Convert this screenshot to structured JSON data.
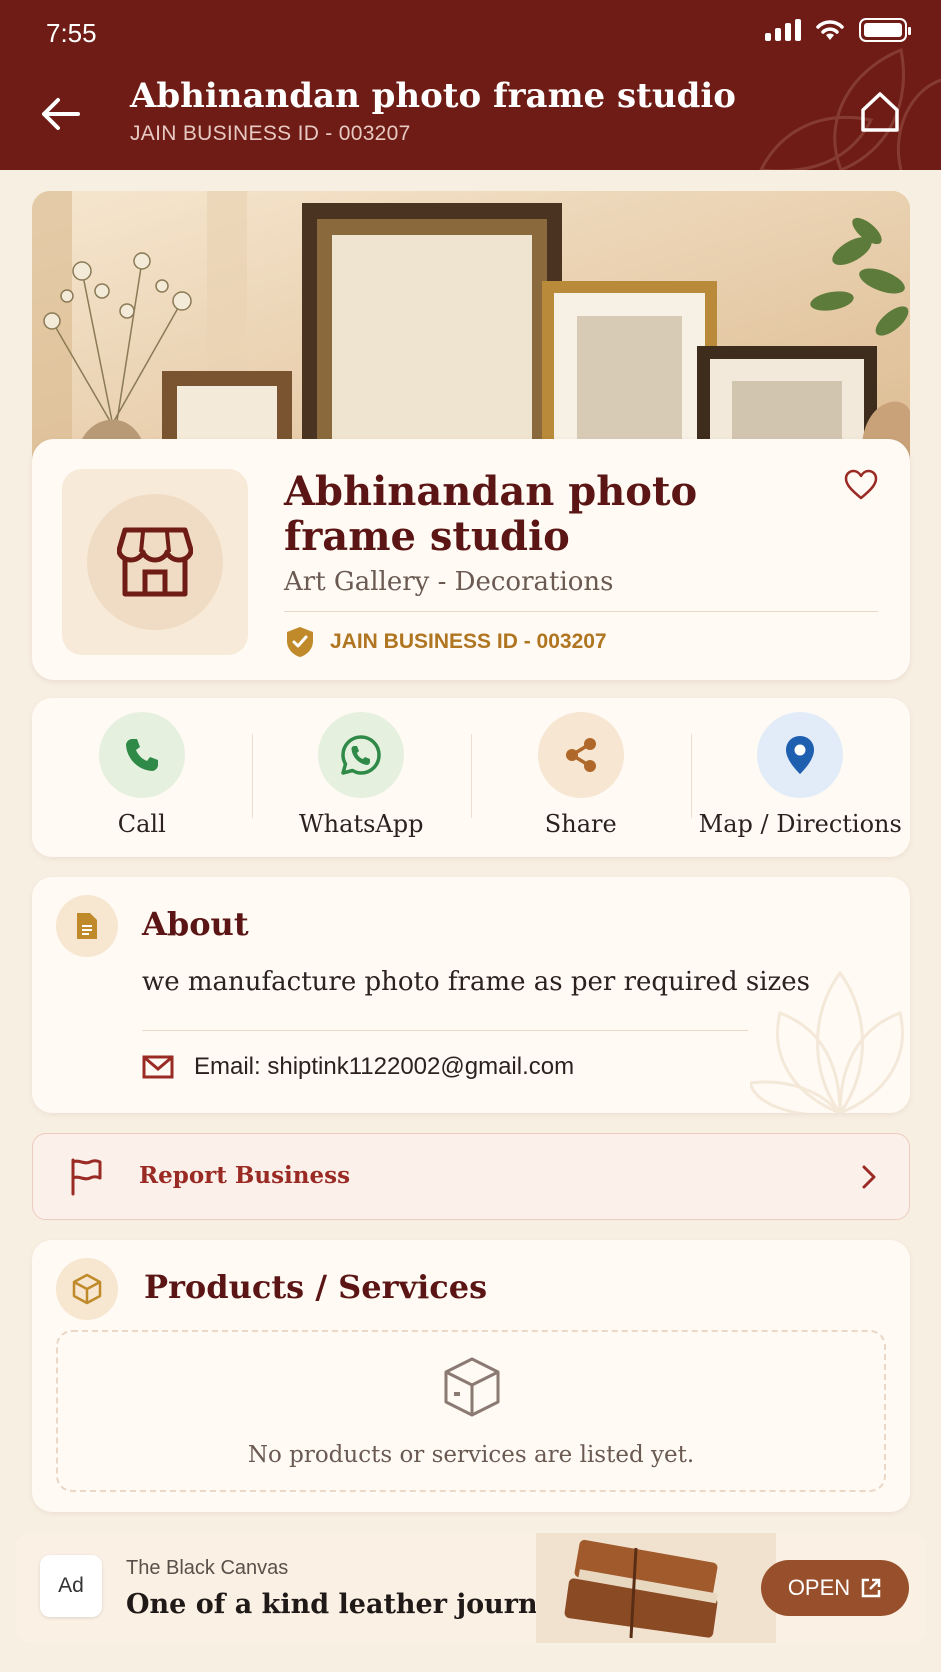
{
  "status_bar": {
    "time": "7:55"
  },
  "header": {
    "title": "Abhinandan photo frame studio",
    "subtitle": "JAIN BUSINESS ID - 003207"
  },
  "business": {
    "name": "Abhinandan photo frame studio",
    "category": "Art Gallery - Decorations",
    "id_label": "JAIN BUSINESS ID - 003207"
  },
  "actions": [
    {
      "label": "Call",
      "icon": "phone-icon",
      "color": "#2f8a48"
    },
    {
      "label": "WhatsApp",
      "icon": "whatsapp-icon",
      "color": "#2f8a48"
    },
    {
      "label": "Share",
      "icon": "share-icon",
      "color": "#b0682a"
    },
    {
      "label": "Map / Directions",
      "icon": "location-pin-icon",
      "color": "#1e5fb0"
    }
  ],
  "about": {
    "title": "About",
    "text": "we manufacture photo frame as per required sizes",
    "email": "Email: shiptink1122002@gmail.com"
  },
  "report": {
    "label": "Report Business"
  },
  "products": {
    "title": "Products / Services",
    "empty_text": "No products or services are listed yet."
  },
  "ad": {
    "badge": "Ad",
    "brand": "The Black Canvas",
    "headline": "One of a kind leather journals",
    "cta": "OPEN"
  },
  "colors": {
    "header_bg": "#6e1c15",
    "accent_gold": "#b07520",
    "page_bg": "#f8efe3"
  }
}
